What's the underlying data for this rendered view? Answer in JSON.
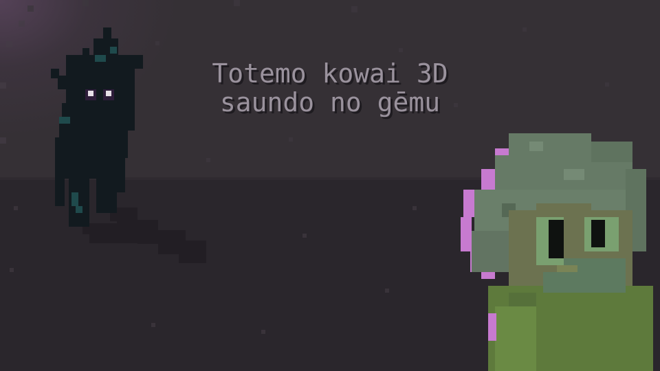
{
  "scene": {
    "title_line_1": "Totemo kowai 3D",
    "title_line_2": "saundo no gēmu"
  },
  "colors": {
    "wall": "#353035",
    "floor": "#2a262c",
    "title_text": "#9a929d",
    "creature_body": "#121a1f",
    "creature_accent": "#1f4a4c",
    "creature_eyes": "#e8e0e8",
    "character_hair": "#667a66",
    "character_hair_outline": "#c77ad0",
    "character_face": "#6c7250",
    "character_eye": "#7aa070",
    "character_shirt": "#5e7a3c"
  },
  "icons": {
    "creature": "shadow-creature-icon",
    "character": "green-character-icon"
  }
}
